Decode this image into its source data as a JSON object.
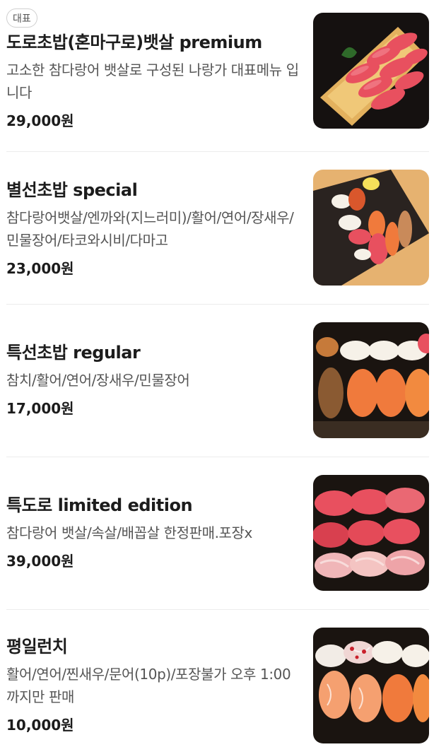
{
  "menu": {
    "items": [
      {
        "badge": "대표",
        "name": "도로초밥(혼마구로)뱃살 premium",
        "desc": "고소한 참다랑어 뱃살로 구성된 나랑가 대표메뉴 입니다",
        "price": "29,000원"
      },
      {
        "badge": "",
        "name": "별선초밥 special",
        "desc": "참다랑어뱃살/엔까와(지느러미)/활어/연어/장새우/민물장어/타코와시비/다마고",
        "price": "23,000원"
      },
      {
        "badge": "",
        "name": "특선초밥 regular",
        "desc": "참치/활어/연어/장새우/민물장어",
        "price": "17,000원"
      },
      {
        "badge": "",
        "name": "특도로 limited edition",
        "desc": "참다랑어 뱃살/속살/배꼽살 한정판매.포장x",
        "price": "39,000원"
      },
      {
        "badge": "",
        "name": "평일런치",
        "desc": "활어/연어/찐새우/문어(10p)/포장불가 오후 1:00까지만 판매",
        "price": "10,000원"
      }
    ]
  },
  "colors": {
    "text_primary": "#1c1c1c",
    "text_secondary": "#555555",
    "divider": "#ececec",
    "tuna": "#e8505f",
    "salmon": "#f07a3c",
    "rice": "#f6f1e8",
    "wood": "#e3b15e",
    "dark_bg": "#1a1410"
  }
}
